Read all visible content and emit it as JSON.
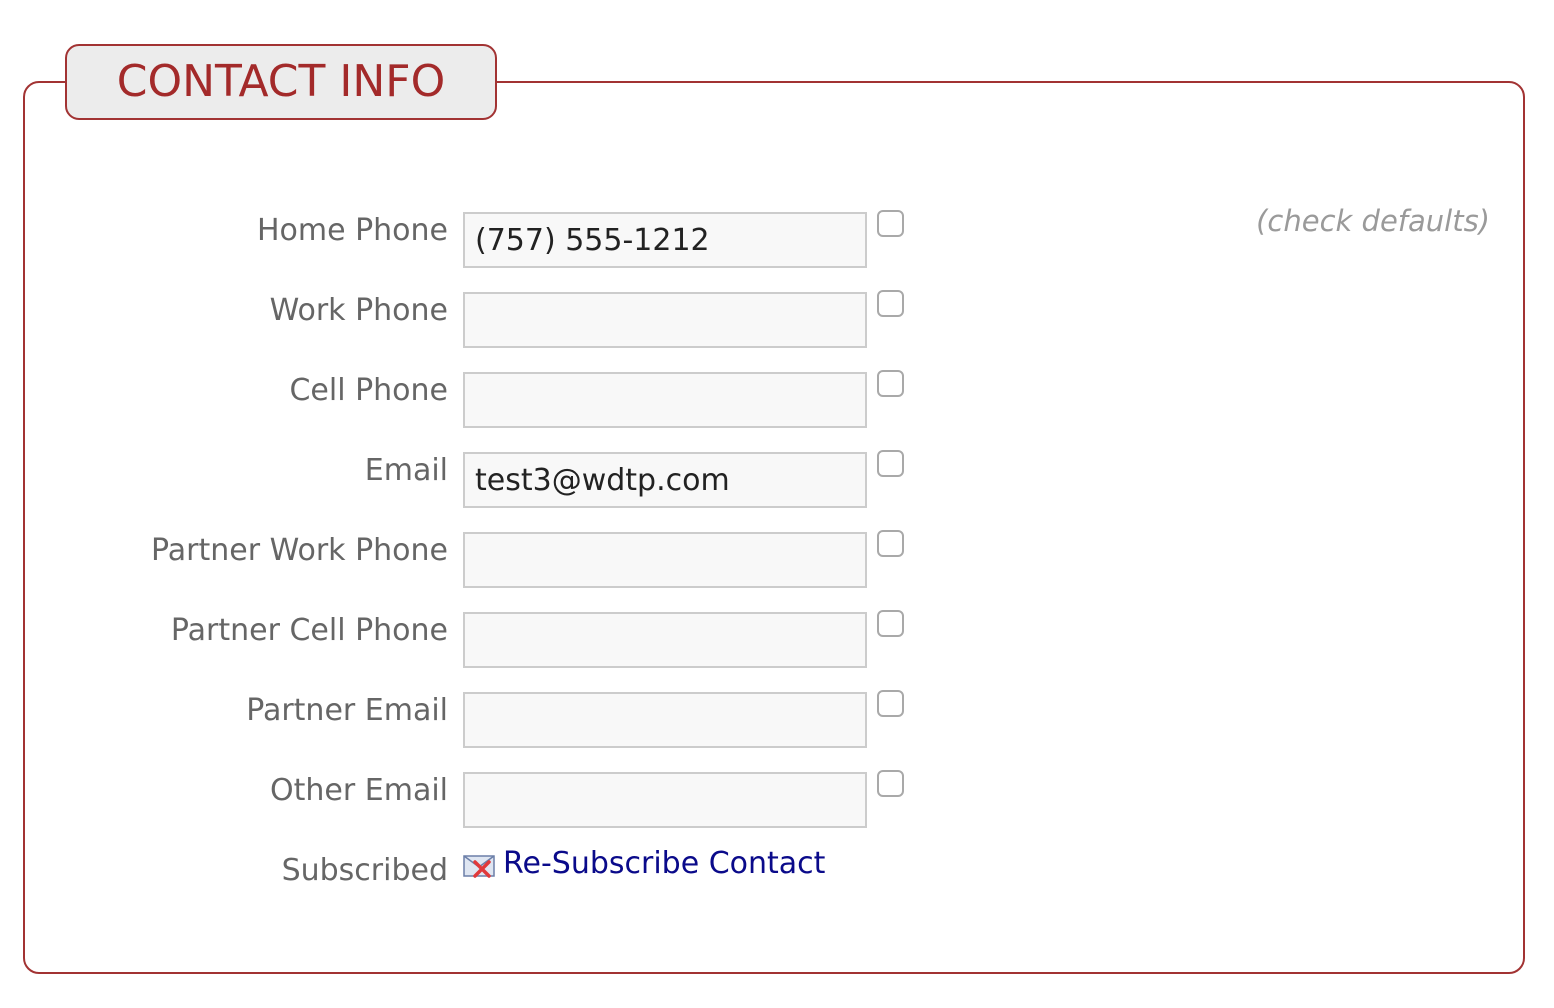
{
  "panel": {
    "title": "CONTACT INFO",
    "hint": "(check defaults)",
    "accent_color": "#a23333"
  },
  "fields": [
    {
      "label": "Home Phone",
      "value": "(757) 555-1212",
      "checked": false
    },
    {
      "label": "Work Phone",
      "value": "",
      "checked": false
    },
    {
      "label": "Cell Phone",
      "value": "",
      "checked": false
    },
    {
      "label": "Email",
      "value": "test3@wdtp.com",
      "checked": false
    },
    {
      "label": "Partner Work Phone",
      "value": "",
      "checked": false
    },
    {
      "label": "Partner Cell Phone",
      "value": "",
      "checked": false
    },
    {
      "label": "Partner Email",
      "value": "",
      "checked": false
    },
    {
      "label": "Other Email",
      "value": "",
      "checked": false
    }
  ],
  "subscription": {
    "label": "Subscribed",
    "icon": "unsubscribed-mail-icon",
    "link_text": "Re-Subscribe Contact",
    "link_color": "#0a0a8a"
  }
}
